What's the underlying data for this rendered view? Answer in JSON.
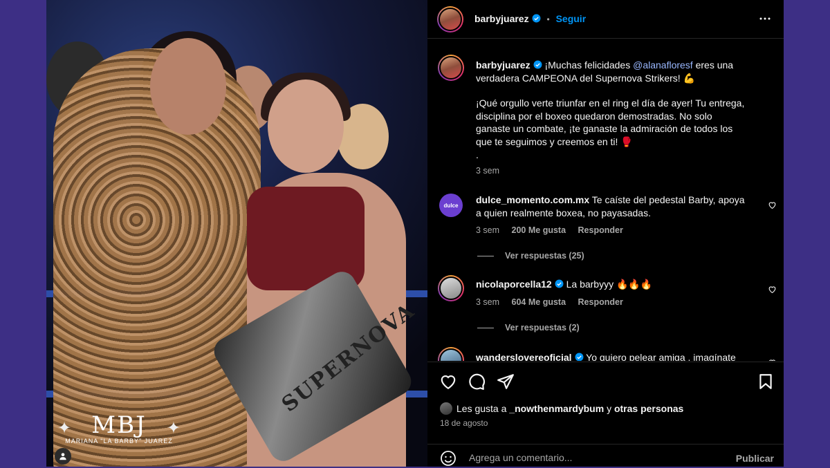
{
  "post": {
    "author": "barbyjuarez",
    "follow_label": "Seguir",
    "dot_separator": "•",
    "watermark_logo": "MBJ",
    "watermark_text": "MARIANA \"LA BARBY\" JUAREZ",
    "belt_text": "SUPERNOVA"
  },
  "caption": {
    "username": "barbyjuarez",
    "line1_before": "¡Muchas felicidades ",
    "mention": "@alanafloresf",
    "line1_after": " eres una verdadera CAMPEONA del Supernova Strikers! 💪",
    "paragraph2": "¡Qué orgullo verte triunfar en el ring el día de ayer! Tu entrega, disciplina por el boxeo quedaron demostradas. No solo ganaste un combate, ¡te ganaste la admiración de todos los que te seguimos y creemos en ti! 🥊",
    "dot": ".",
    "time": "3 sem"
  },
  "comments": [
    {
      "username": "dulce_momento.com.mx",
      "avatar_label": "dulce",
      "text": "Te caíste del pedestal Barby, apoya a quien realmente boxea, no payasadas.",
      "time": "3 sem",
      "likes": "200 Me gusta",
      "reply": "Responder",
      "replies": "Ver respuestas (25)"
    },
    {
      "username": "nicolaporcella12",
      "text": "La barbyyy 🔥🔥🔥",
      "time": "3 sem",
      "likes": "604 Me gusta",
      "reply": "Responder",
      "replies": "Ver respuestas (2)"
    },
    {
      "username": "wanderslovereoficial",
      "text": "Yo quiero pelear amiga , imagínate"
    }
  ],
  "likes_line": {
    "prefix": "Les gusta a ",
    "user": "_nowthenmardybum",
    "middle": " y ",
    "others": "otras personas"
  },
  "date": "18 de agosto",
  "add_comment": {
    "placeholder": "Agrega un comentario...",
    "publish": "Publicar"
  },
  "colors": {
    "background": "#3d2f85",
    "accent": "#0095f6",
    "panel": "#000000"
  }
}
